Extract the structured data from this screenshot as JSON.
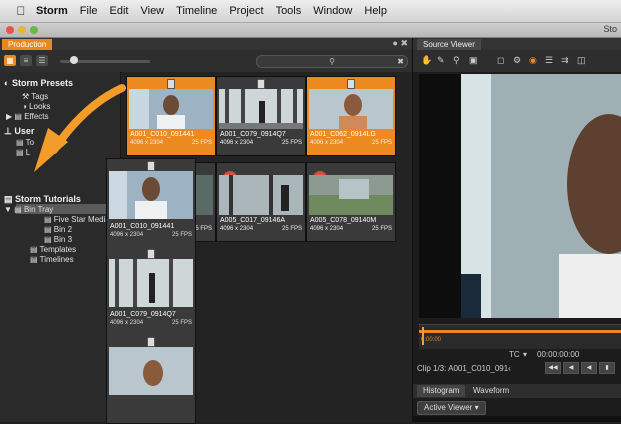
{
  "menubar": {
    "app": "Storm",
    "items": [
      "File",
      "Edit",
      "View",
      "Timeline",
      "Project",
      "Tools",
      "Window",
      "Help"
    ]
  },
  "window": {
    "title": "Sto"
  },
  "production": {
    "tab_label": "Production",
    "search_placeholder": "",
    "tree": {
      "storm_presets": "Storm Presets",
      "tags": "Tags",
      "looks": "Looks",
      "effects": "Effects",
      "user": "User",
      "user_c1": "To",
      "user_c2": "L",
      "storm_tutorials": "Storm Tutorials",
      "bin_tray": "Bin Tray",
      "five_star": "Five Star Media",
      "bin2": "Bin 2",
      "bin3": "Bin 3",
      "templates": "Templates",
      "timelines": "Timelines"
    },
    "clips": [
      {
        "name": "A001_C010_091441",
        "res": "4096 x 2304",
        "fps": "25 FPS"
      },
      {
        "name": "A001_C079_0914Q7",
        "res": "4096 x 2304",
        "fps": "25 FPS"
      },
      {
        "name": "A001_C062_0914LG",
        "res": "4096 x 2304",
        "fps": "25 FPS"
      },
      {
        "name": "",
        "res": "",
        "fps": "25 FPS"
      },
      {
        "name": "A005_C017_09146A",
        "res": "4096 x 2304",
        "fps": "25 FPS"
      },
      {
        "name": "A005_C078_09140M",
        "res": "4096 x 2304",
        "fps": "25 FPS"
      }
    ],
    "drag_stack": [
      {
        "name": "A001_C010_091441",
        "res": "4096 x 2304",
        "fps": "25 FPS"
      },
      {
        "name": "A001_C079_0914Q7",
        "res": "4096 x 2304",
        "fps": "25 FPS"
      }
    ]
  },
  "viewer": {
    "tab_label": "Source Viewer",
    "timecode_label": "TC",
    "timecode_value": "00:00:00:00",
    "clip_label": "Clip 1/3: A001_C010_091‹",
    "scrub_start": "0:00:00",
    "scope_tabs": [
      "Histogram",
      "Waveform"
    ],
    "active_viewer": "Active Viewer"
  },
  "colors": {
    "accent": "#e8881f",
    "tab_active": "#e8881f"
  }
}
